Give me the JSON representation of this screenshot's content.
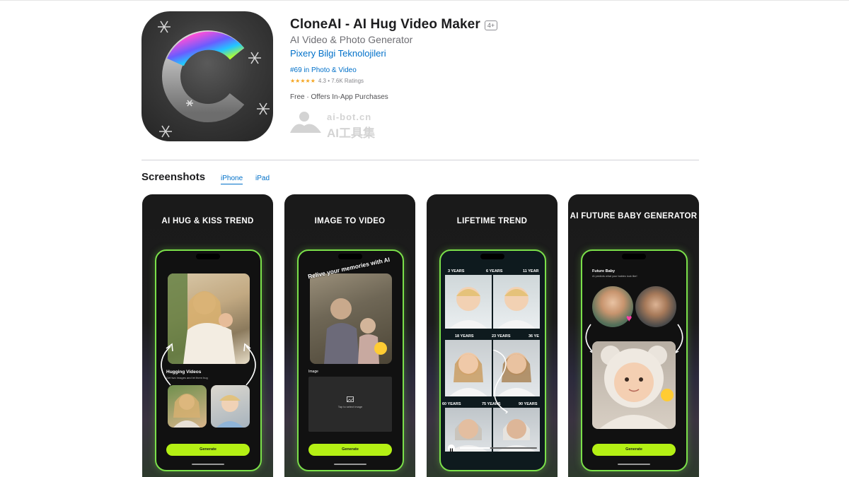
{
  "app": {
    "title": "CloneAI - AI Hug Video Maker",
    "age_rating": "4+",
    "subtitle": "AI Video & Photo Generator",
    "developer": "Pixery Bilgi Teknolojileri",
    "rank": "#69 in Photo & Video",
    "stars": "★★★★★",
    "rating": "4.3 • 7.6K Ratings",
    "rating_value": 4.3,
    "price": "Free · Offers In-App Purchases"
  },
  "watermark": {
    "url": "ai-bot.cn",
    "name": "AI工具集"
  },
  "screenshots": {
    "heading": "Screenshots",
    "tabs": [
      "iPhone",
      "iPad"
    ],
    "selected_tab": "iPhone",
    "items": [
      {
        "caption": "AI HUG & KISS TREND",
        "section_title": "Hugging Videos",
        "section_sub": "Get two images and let them hug",
        "button": "Generate"
      },
      {
        "caption": "IMAGE TO VIDEO",
        "overlay": "Relive your memories with AI",
        "section_title": "Image",
        "placeholder": "Tap to select image",
        "button": "Generate"
      },
      {
        "caption": "LIFETIME TREND",
        "years": [
          "3 YEARS",
          "6 YEARS",
          "11 YEAR",
          "18 YEARS",
          "23 YEARS",
          "36 YE",
          "60 YEARS",
          "75 YEARS",
          "90 YEARS"
        ]
      },
      {
        "caption": "AI FUTURE BABY GENERATOR",
        "section_title": "Future Baby",
        "section_sub": "AI predicts what your babies look like!",
        "button": "Generate"
      }
    ]
  },
  "colors": {
    "link": "#0070c9",
    "accent_green": "#b4f014",
    "star": "#f5a623"
  }
}
